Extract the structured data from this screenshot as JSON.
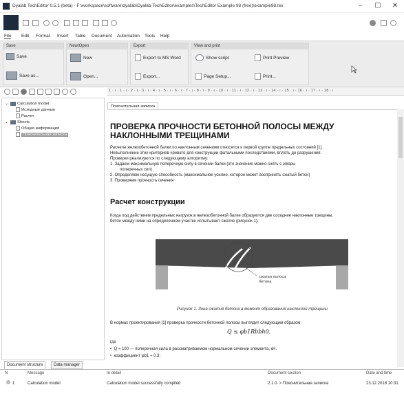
{
  "window": {
    "title": "Dyalab TechEditor 0.5.1 (beta) - F:\\workspace\\software\\dyalab\\Dyalab TechEditor\\examples\\TechEditor Example 98 (free)\\example98.tex",
    "minimize": "−",
    "maximize": "☐",
    "close": "✕"
  },
  "menu": [
    "File",
    "Edit",
    "Format",
    "Insert",
    "Table",
    "Document",
    "Automation",
    "Tools",
    "Help"
  ],
  "ribbon": {
    "save": {
      "title": "Save",
      "save": "Save",
      "save_as": "Save as..."
    },
    "newopen": {
      "title": "New/Open",
      "new": "New",
      "open": "Open..."
    },
    "export": {
      "title": "Export",
      "word": "Export to MS Word",
      "export": "Export..."
    },
    "view": {
      "title": "View and print",
      "script": "Show script",
      "preview": "Print Preview",
      "page_setup": "Page Setup...",
      "print": "Print..."
    }
  },
  "tree": {
    "model": "Calculation model",
    "input": "Исходные данные",
    "calc": "Расчет",
    "sheets": "Sheets",
    "general": "Общая информация",
    "selected": "Пояснительная записка"
  },
  "left_tabs": {
    "structure": "Document structure",
    "data": "Data manager"
  },
  "ruler": "1 · ı · 1 · ı · 2 · ı · 3 · ı · 4 · ı · 5 · ı · 6 · ı · 7 · ı · 8 · ı · 9 · ı · 10 · ı · 11 · ı · 12 · ı · 13 · ı · 14 · ı · 15 · ı · 16 · ı · 17 · ı · 18 · ı",
  "doc_tab": "Пояснительная записка",
  "doc": {
    "title1": "ПРОВЕРКА ПРОЧНОСТИ БЕТОННОЙ ПОЛОСЫ МЕЖДУ",
    "title2": "НАКЛОННЫМИ ТРЕЩИНАМИ",
    "intro1": "Расчеты железобетонной балки по наклонным сечениям относятся к первой группе предельных состояний [1].",
    "intro2": "Невыполнение этих критериев чревато для конструкции фатальными последствиями, вплоть до разрушения.",
    "intro3": "Проверки реализуются по следующему алгоритму:",
    "step1": "1.   Задаем максимальную поперечную силу в сечении балки (это значение можно снять с эпюры",
    "step1b": "поперечных сил)",
    "step2": "2.   Определяем несущую способность (максимальное усилие, которое может воспринять сжатый бетон)",
    "step3": "3.   Проверяем прочность сечения",
    "h2": "Расчет конструкции",
    "p2a": "Когда под действием предельных нагрузок в железобетонной балке образуются две соседние наклонные трещины,",
    "p2b": "бетон между ними на определенном участке испытывает сжатие (рисунок 1).",
    "fig_label1": "сжатая полоса",
    "fig_label2": "бетона",
    "caption": "Рисунок 1. Зона сжатия бетона в момент образования наклонной трещины",
    "p3": "В нормах проектирования [1] проверка прочности бетонной полосы выглядит следующим образом:",
    "formula": "Q ≤ φb1Rbbh0.",
    "where": "где",
    "b1": "Q = 100 — поперечная сила в рассматриваемом нормальном сечении элемента, кН.",
    "b2": "коэффициент φb1 = 0.3;"
  },
  "status": {
    "headers": [
      "N",
      "Message",
      "In detail",
      "Document section",
      "Date and time"
    ],
    "row": [
      "1",
      "Calculation model",
      "Calculation model successfully compiled",
      "2.1.0. > Пояснительная записка",
      "23.12.2018 10:31"
    ]
  },
  "colors": {
    "ribbon_bg": "#ececec",
    "beam": "#4a4a4a",
    "support": "#a8a8a8"
  }
}
